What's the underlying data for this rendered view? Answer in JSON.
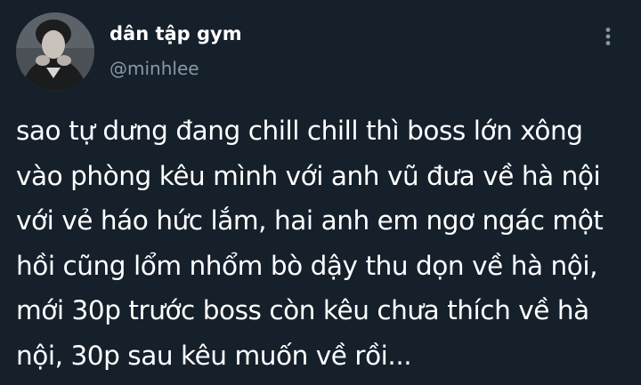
{
  "tweet": {
    "display_name": "dân tập gym",
    "handle": "@minhlee",
    "more_icon": "more-vertical-icon",
    "text_lines": [
      "sao tự dưng đang chill chill thì boss lớn xông",
      "vào phòng kêu mình với anh vũ đưa về hà nội",
      "với vẻ háo hức lắm, hai anh em ngơ ngác một",
      "hồi cũng lổm nhổm bò dậy thu dọn về hà nội,",
      "mới 30p trước boss còn kêu chưa thích về hà",
      "nội, 30p sau kêu muốn về rồi..."
    ]
  },
  "colors": {
    "background": "#15202b",
    "primary_text": "#ffffff",
    "secondary_text": "#8899a6"
  }
}
